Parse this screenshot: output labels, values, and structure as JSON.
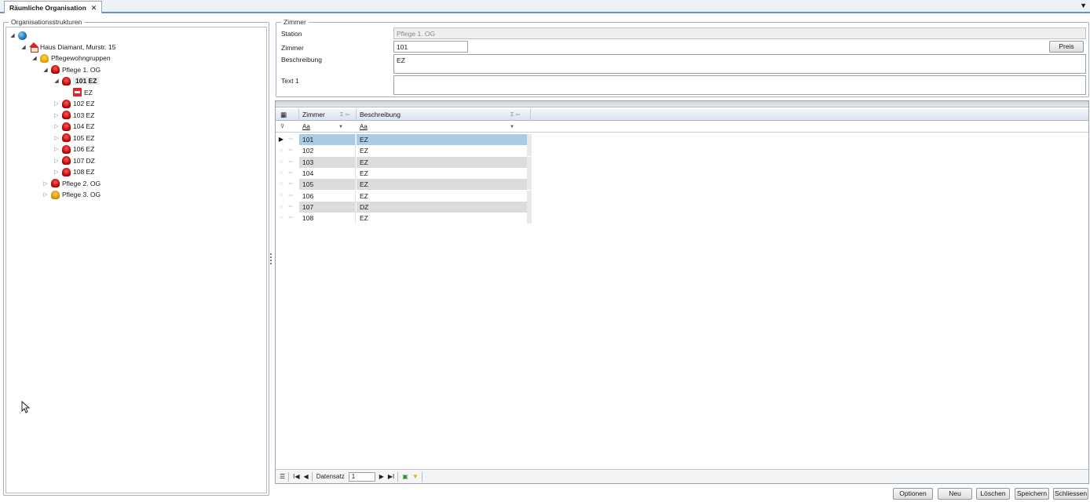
{
  "tabs": [
    {
      "label": "Räumliche Organisation",
      "close": "✕"
    }
  ],
  "tab_menu_icon": "▼",
  "left_panel": {
    "title": "Organisationsstrukturen",
    "tree": [
      {
        "label": "",
        "icon": "globe-icon",
        "level": 0,
        "expanded": true
      },
      {
        "label": "Haus Diamant, Murstr. 15",
        "icon": "house-icon",
        "level": 1,
        "expanded": true
      },
      {
        "label": "Pflegewohngruppen",
        "icon": "group-icon",
        "level": 2,
        "expanded": true
      },
      {
        "label": "Pflege 1. OG",
        "icon": "station-icon",
        "level": 3,
        "expanded": true
      },
      {
        "label": "101 EZ",
        "icon": "station-icon",
        "level": 4,
        "expanded": true,
        "selected": true
      },
      {
        "label": "EZ",
        "icon": "bed-icon",
        "level": 5
      },
      {
        "label": "102 EZ",
        "icon": "station-icon",
        "level": 4,
        "expanded": false
      },
      {
        "label": "103 EZ",
        "icon": "station-icon",
        "level": 4,
        "expanded": false
      },
      {
        "label": "104 EZ",
        "icon": "station-icon",
        "level": 4,
        "expanded": false
      },
      {
        "label": "105 EZ",
        "icon": "station-icon",
        "level": 4,
        "expanded": false
      },
      {
        "label": "106 EZ",
        "icon": "station-icon",
        "level": 4,
        "expanded": false
      },
      {
        "label": "107 DZ",
        "icon": "station-icon",
        "level": 4,
        "expanded": false
      },
      {
        "label": "108 EZ",
        "icon": "station-icon",
        "level": 4,
        "expanded": false
      },
      {
        "label": "Pflege 2. OG",
        "icon": "station-icon",
        "level": 3,
        "expanded": false
      },
      {
        "label": "Pflege 3. OG",
        "icon": "station-gold-icon",
        "level": 3,
        "expanded": false
      }
    ]
  },
  "detail": {
    "title": "Zimmer",
    "station_label": "Station",
    "station_value": "Pflege 1. OG",
    "zimmer_label": "Zimmer",
    "zimmer_value": "101",
    "preis_button": "Preis",
    "beschreibung_label": "Beschreibung",
    "beschreibung_value": "EZ",
    "text1_label": "Text 1",
    "text1_value": ""
  },
  "grid": {
    "columns": [
      "Zimmer",
      "Beschreibung"
    ],
    "filter": [
      "Aa",
      "Aa"
    ],
    "current_row": 0,
    "rows": [
      {
        "zimmer": "101",
        "beschreibung": "EZ"
      },
      {
        "zimmer": "102",
        "beschreibung": "EZ"
      },
      {
        "zimmer": "103",
        "beschreibung": "EZ"
      },
      {
        "zimmer": "104",
        "beschreibung": "EZ"
      },
      {
        "zimmer": "105",
        "beschreibung": "EZ"
      },
      {
        "zimmer": "106",
        "beschreibung": "EZ"
      },
      {
        "zimmer": "107",
        "beschreibung": "DZ"
      },
      {
        "zimmer": "108",
        "beschreibung": "EZ"
      }
    ],
    "navigator": {
      "first": "I◀",
      "prev": "◀",
      "record_label": "Datensatz",
      "record_value": "1",
      "next": "▶",
      "last": "▶I"
    }
  },
  "buttons": {
    "optionen": "Optionen",
    "neu": "Neu",
    "loeschen": "Löschen",
    "speichern": "Speichern",
    "schliessen": "Schliessen"
  },
  "colors": {
    "selection": "#a9cbe6",
    "alt_row": "#dcdcdc",
    "accent": "#6e8fc0"
  }
}
